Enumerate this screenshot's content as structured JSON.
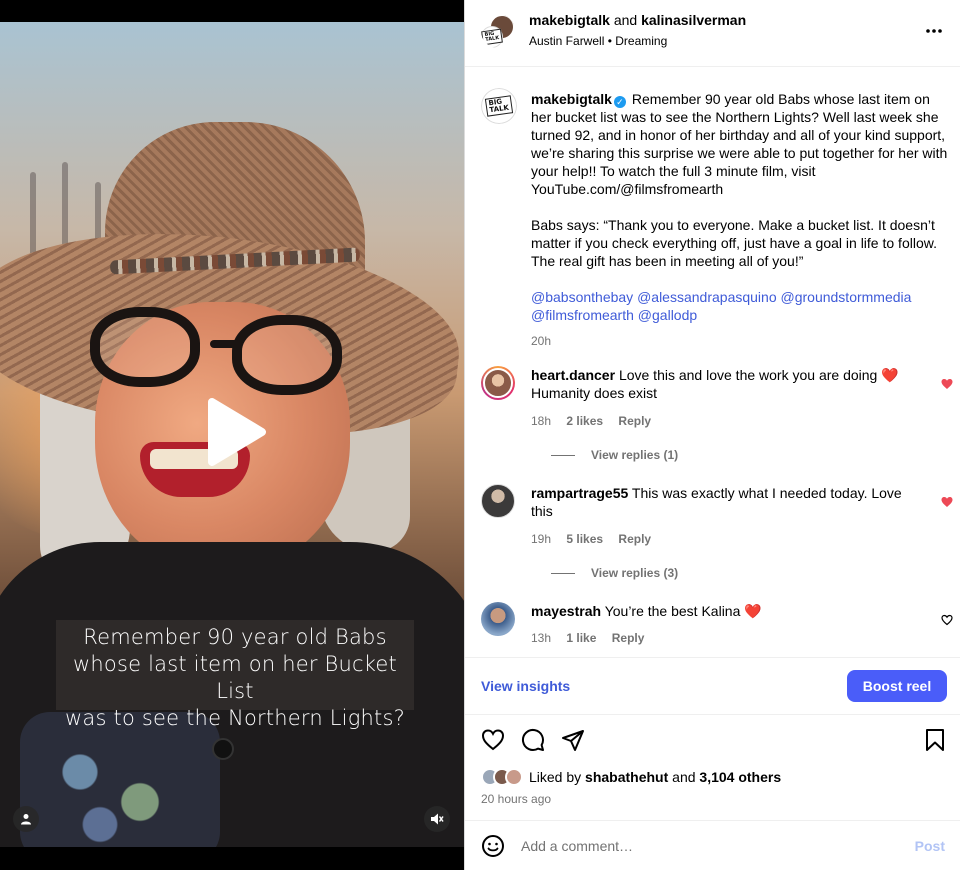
{
  "video": {
    "caption_lines": [
      "Remember 90 year old Babs",
      "whose last item on her Bucket List",
      "was to see the Northern Lights?"
    ],
    "play_icon": "play-icon",
    "user_tag_icon": "user-tag-icon",
    "mute_icon": "muted-speaker-icon"
  },
  "header": {
    "author": "makebigtalk",
    "and_text": "and",
    "collaborator": "kalinasilverman",
    "audio_artist": "Austin Farwell",
    "separator": "•",
    "audio_title": "Dreaming",
    "more_icon": "more-horizontal-icon"
  },
  "post": {
    "author": "makebigtalk",
    "verified_icon": "verified-badge-icon",
    "paragraph1": "Remember 90 year old Babs whose last item on her bucket list was to see the Northern Lights? Well last week she turned 92, and in honor of her birthday and all of your kind support, we’re sharing this surprise we were able to put together for her with your help!! To watch the full 3 minute film, visit YouTube.com/@filmsfromearth",
    "paragraph2": "Babs says: “Thank you to everyone. Make a bucket list. It doesn’t matter if you check everything off, just have a goal in life to follow. The real gift has been in meeting all of you!”",
    "mentions": [
      "@babsonthebay",
      "@alessandrapasquino",
      "@groundstormmedia",
      "@filmsfromearth",
      "@gallodp"
    ],
    "time": "20h"
  },
  "comments": [
    {
      "user": "heart.dancer",
      "text": "Love this and love the work you are doing ❤️ Humanity does exist",
      "time": "18h",
      "likes": "2 likes",
      "reply": "Reply",
      "view_replies": "View replies (1)",
      "liked": true
    },
    {
      "user": "rampartrage55",
      "text": "This was exactly what I needed today. Love this",
      "time": "19h",
      "likes": "5 likes",
      "reply": "Reply",
      "view_replies": "View replies (3)",
      "liked": true
    },
    {
      "user": "mayestrah",
      "text": "You’re the best Kalina ❤️",
      "time": "13h",
      "likes": "1 like",
      "reply": "Reply",
      "liked": false
    }
  ],
  "actions": {
    "view_insights": "View insights",
    "boost": "Boost reel",
    "like_icon": "heart-icon",
    "comment_icon": "comment-icon",
    "share_icon": "send-icon",
    "save_icon": "bookmark-icon"
  },
  "likes": {
    "liked_by_prefix": "Liked by",
    "liked_by_user": "shabathehut",
    "and": "and",
    "others": "3,104 others",
    "time_ago": "20 hours ago"
  },
  "comment_box": {
    "placeholder": "Add a comment…",
    "post_label": "Post",
    "emoji_icon": "emoji-icon"
  },
  "colors": {
    "accent": "#4a5df9",
    "link": "#3f5bd8",
    "heart": "#ed4956",
    "muted": "#737373"
  }
}
